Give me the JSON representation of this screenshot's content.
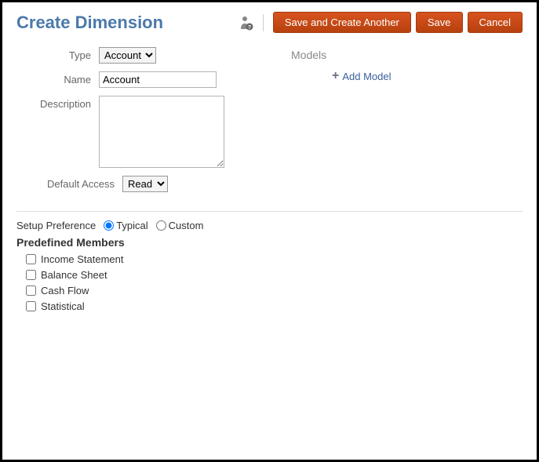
{
  "header": {
    "title": "Create Dimension",
    "buttons": {
      "save_create": "Save and Create Another",
      "save": "Save",
      "cancel": "Cancel"
    }
  },
  "form": {
    "type_label": "Type",
    "type_value": "Account",
    "name_label": "Name",
    "name_value": "Account",
    "description_label": "Description",
    "description_value": "",
    "default_access_label": "Default Access",
    "default_access_value": "Read"
  },
  "models": {
    "heading": "Models",
    "add_label": "Add Model"
  },
  "setup": {
    "label": "Setup Preference",
    "typical_label": "Typical",
    "custom_label": "Custom",
    "selected": "typical"
  },
  "predefined": {
    "heading": "Predefined Members",
    "items": [
      "Income Statement",
      "Balance Sheet",
      "Cash Flow",
      "Statistical"
    ]
  }
}
